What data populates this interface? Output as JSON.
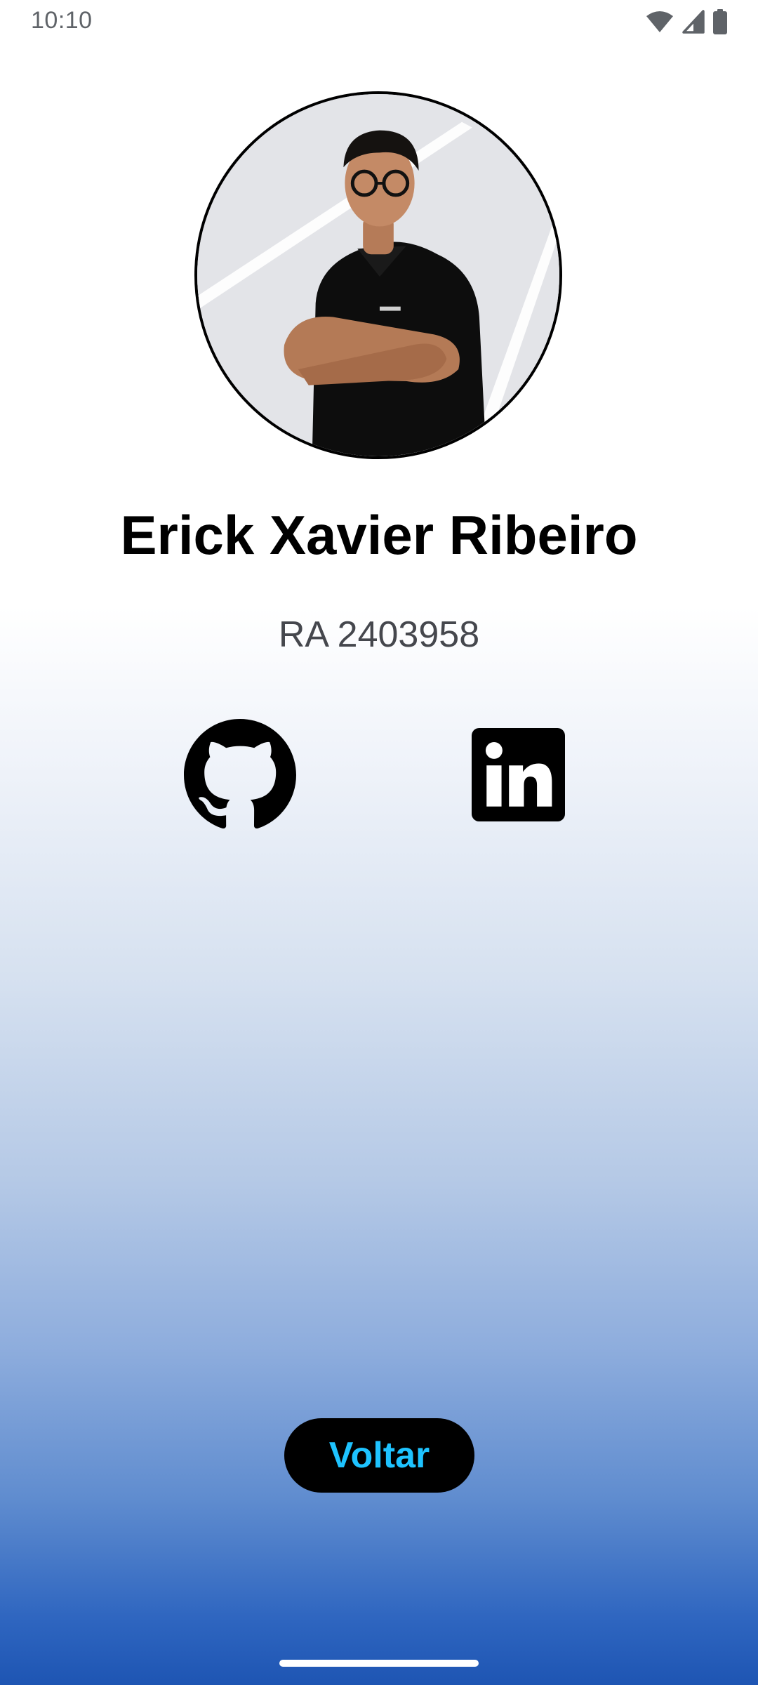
{
  "status_bar": {
    "time": "10:10",
    "icons": [
      "wifi-icon",
      "cell-signal-icon",
      "battery-icon"
    ]
  },
  "profile": {
    "avatar": "avatar-photo",
    "name": "Erick Xavier Ribeiro",
    "ra": "RA 2403958"
  },
  "social": [
    {
      "icon": "github-icon",
      "color": "#000000"
    },
    {
      "icon": "linkedin-icon",
      "color": "#000000"
    }
  ],
  "actions": {
    "back_label": "Voltar"
  },
  "colors": {
    "button_background": "#000000",
    "button_text": "#1ec3ff",
    "gradient_bottom": "#1e55b3"
  }
}
